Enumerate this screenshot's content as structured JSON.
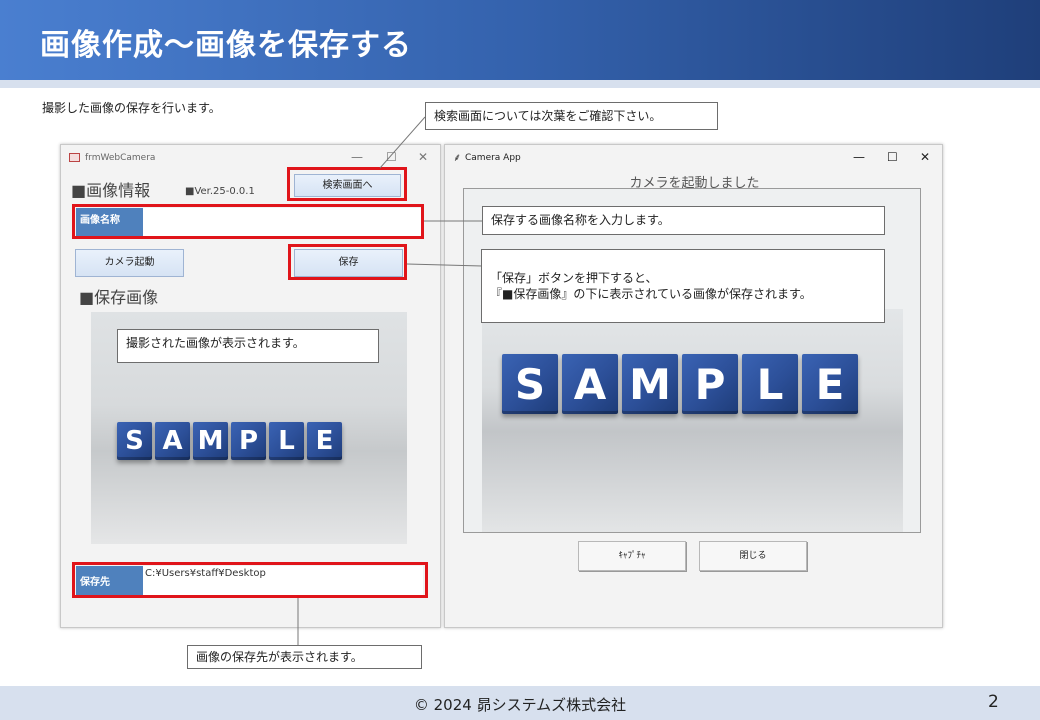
{
  "slide": {
    "title": "画像作成～画像を保存する",
    "intro": "撮影した画像の保存を行います。",
    "footer": "© 2024 昴システムズ株式会社",
    "page_number": "2"
  },
  "callouts": {
    "search_note": "検索画面については次葉をご確認下さい。",
    "name_note": "保存する画像名称を入力します。",
    "save_note_line1": "「保存」ボタンを押下すると、",
    "save_note_line2": "『■保存画像』の下に表示されている画像が保存されます。",
    "image_note": "撮影された画像が表示されます。",
    "path_note": "画像の保存先が表示されます。"
  },
  "left_window": {
    "title": "frmWebCamera",
    "section_info": "■画像情報",
    "version": "■Ver.25-0.0.1",
    "search_button": "検索画面へ",
    "image_name_label": "画像名称",
    "image_name_value": "",
    "camera_button": "カメラ起動",
    "save_button": "保存",
    "section_saved": "■保存画像",
    "image_text": "SAMPLE",
    "save_path_label": "保存先",
    "save_path_value": "C:¥Users¥staff¥Desktop"
  },
  "right_window": {
    "title": "Camera App",
    "status": "カメラを起動しました",
    "image_text": "SAMPLE",
    "capture_button": "ｷｬﾌﾟﾁｬ",
    "close_button": "閉じる"
  },
  "colors": {
    "header_start": "#4a7fd0",
    "header_end": "#1f3f7a",
    "highlight": "#e0141a",
    "cube_blue": "#2c4f98"
  }
}
